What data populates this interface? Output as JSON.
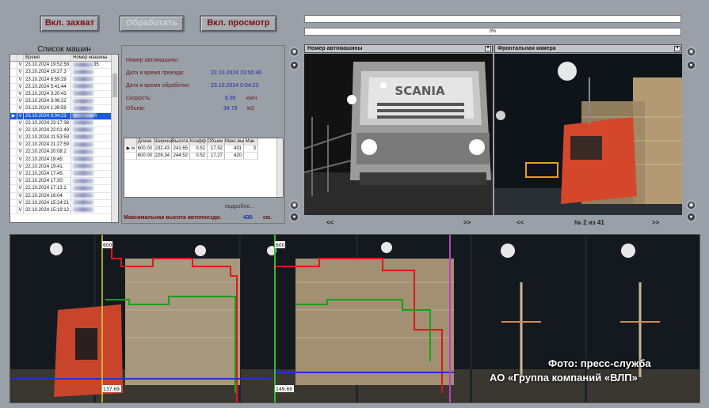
{
  "toolbar": {
    "capture_label": "Вкл. захват",
    "process_label": "Обработать",
    "view_label": "Вкл. просмотр"
  },
  "progress": {
    "text": "0%",
    "value": 0
  },
  "car_list": {
    "title": "Список машин",
    "col_time": "Время",
    "col_number": "Номер машины",
    "rows": [
      {
        "check": "V",
        "time": "23.10.2024 19:52:58",
        "number": "35"
      },
      {
        "check": "V",
        "time": "23.10.2024 19:27:3",
        "number": ""
      },
      {
        "check": "V",
        "time": "23.10.2024 6:59:29",
        "number": ""
      },
      {
        "check": "V",
        "time": "23.10.2024 5:41:44",
        "number": ""
      },
      {
        "check": "V",
        "time": "23.10.2024 3:20:43",
        "number": ""
      },
      {
        "check": "V",
        "time": "23.10.2024 3:06:22",
        "number": ""
      },
      {
        "check": "V",
        "time": "23.10.2024 1:26:59",
        "number": ""
      },
      {
        "check": "V",
        "time": "23.10.2024 0:04:23",
        "number": "R",
        "selected": true
      },
      {
        "check": "V",
        "time": "22.10.2024 23:17:38",
        "number": ""
      },
      {
        "check": "V",
        "time": "22.10.2024 22:01:49",
        "number": ""
      },
      {
        "check": "V",
        "time": "22.10.2024 21:53:59",
        "number": ""
      },
      {
        "check": "V",
        "time": "22.10.2024 21:27:59",
        "number": ""
      },
      {
        "check": "V",
        "time": "22.10.2024 20:08:2",
        "number": ""
      },
      {
        "check": "V",
        "time": "22.10.2024 19:45:",
        "number": ""
      },
      {
        "check": "V",
        "time": "22.10.2024 19:41:",
        "number": ""
      },
      {
        "check": "V",
        "time": "22.10.2024 17:45:",
        "number": ""
      },
      {
        "check": "V",
        "time": "22.10.2024 17:30:",
        "number": ""
      },
      {
        "check": "V",
        "time": "22.10.2024 17:13:1",
        "number": ""
      },
      {
        "check": "V",
        "time": "22.10.2024 16:04:",
        "number": ""
      },
      {
        "check": "V",
        "time": "22.10.2024 15:24:21",
        "number": ""
      },
      {
        "check": "V",
        "time": "22.10.2024 15:19:12",
        "number": ""
      }
    ]
  },
  "info": {
    "car_number_label": "Номер автомашины:",
    "passage_label": "Дата и время проезда:",
    "passage_value": "22.10.2024 23:55:46",
    "processing_label": "Дата и время обработки:",
    "processing_value": "23.10.2024 0:04:23",
    "speed_label": "Скорость:",
    "speed_value": "6.96",
    "speed_unit": "км/ч",
    "volume_label": "Объем:",
    "volume_value": "34.79",
    "volume_unit": "м3",
    "details_link": "подробно...",
    "max_height_label": "Максимальная высота автопоезда:",
    "max_height_value": "430",
    "max_height_unit": "см."
  },
  "measure_table": {
    "headers": [
      "",
      "Длина",
      "Ширина",
      "Высота",
      "Коэфф",
      "Объем",
      "Макс.выс",
      "Ман"
    ],
    "rows": [
      [
        "▶ м",
        "600.00",
        "232.43",
        "241.65",
        "0.52",
        "17.52",
        "431",
        "3"
      ],
      [
        "",
        "600.00",
        "226.34",
        "244.52",
        "0.52",
        "17.27",
        "420",
        ""
      ]
    ]
  },
  "cameras": {
    "left_title": "Номер автомашины",
    "right_title": "Фронтальная камера",
    "prev": "<<",
    "next": ">>",
    "frame_info": "№ 2 из 41",
    "brand_text": "SCANIA"
  },
  "strip": {
    "label_a_top": "600",
    "label_a_bottom": "137.69",
    "label_b_top": "600",
    "label_b_bottom": "149.69",
    "credit_line1": "Фото: пресс-служба",
    "credit_line2": "АО «Группа компаний «ВЛП»"
  },
  "colors": {
    "button_text": "#7a1010",
    "selection": "#1c5ad8",
    "value_blue": "#1a2aa8",
    "profile_red": "#e01818",
    "profile_green": "#18a018",
    "profile_blue": "#2030e0"
  }
}
